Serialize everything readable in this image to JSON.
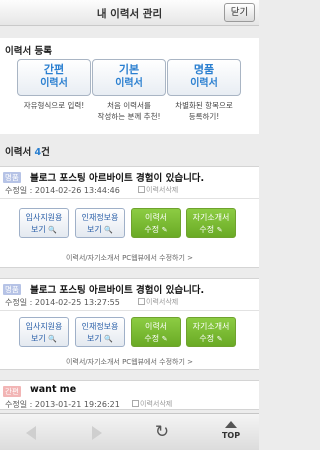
{
  "header": {
    "title": "내 이력서 관리",
    "close_label": "닫기"
  },
  "register": {
    "title": "이력서 등록",
    "buttons": [
      {
        "line1": "간편",
        "line2": "이력서",
        "desc1": "자유형식으로 입력!",
        "desc2": ""
      },
      {
        "line1": "기본",
        "line2": "이력서",
        "desc1": "처음 이력서를",
        "desc2": "작성하는 분께 추천!"
      },
      {
        "line1": "명품",
        "line2": "이력서",
        "desc1": "차별화된 항목으로",
        "desc2": "등록하기!"
      }
    ]
  },
  "list": {
    "label": "이력서",
    "count": "4",
    "unit": "건"
  },
  "resumes": [
    {
      "badge": "명품",
      "title": "블로그 포스팅 아르바이트 경험이 있습니다.",
      "modified": "수정일 : 2014-02-26 13:44:46",
      "delete_label": "이력서삭제",
      "actions": [
        {
          "l1": "입사지원용",
          "l2": "보기",
          "icon": "🔍"
        },
        {
          "l1": "인재정보용",
          "l2": "보기",
          "icon": "🔍"
        },
        {
          "l1": "이력서",
          "l2": "수정",
          "icon": "✎"
        },
        {
          "l1": "자기소개서",
          "l2": "수정",
          "icon": "✎"
        }
      ],
      "note": "이력서/자기소개서 PC웹뷰에서 수정하기 >"
    },
    {
      "badge": "명품",
      "title": "블로그 포스팅 아르바이트 경험이 있습니다.",
      "modified": "수정일 : 2014-02-25 13:27:55",
      "delete_label": "이력서삭제",
      "actions": [
        {
          "l1": "입사지원용",
          "l2": "보기",
          "icon": "🔍"
        },
        {
          "l1": "인재정보용",
          "l2": "보기",
          "icon": "🔍"
        },
        {
          "l1": "이력서",
          "l2": "수정",
          "icon": "✎"
        },
        {
          "l1": "자기소개서",
          "l2": "수정",
          "icon": "✎"
        }
      ],
      "note": "이력서/자기소개서 PC웹뷰에서 수정하기 >"
    },
    {
      "badge": "간편",
      "title": "want me",
      "modified": "수정일 : 2013-01-21 19:26:21",
      "delete_label": "이력서삭제"
    }
  ],
  "footer": {
    "back_icon": "left-arrow-icon",
    "forward_icon": "right-arrow-icon",
    "refresh_icon": "↻",
    "top_label": "TOP"
  }
}
